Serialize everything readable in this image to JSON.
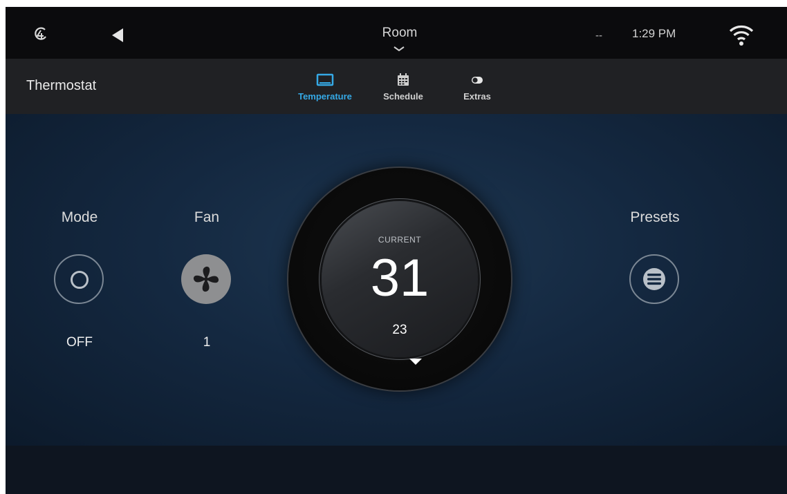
{
  "topbar": {
    "logo_icon": "brand-logo-icon",
    "back_icon": "back-triangle-icon",
    "room_label": "Room",
    "status_dashes": "--",
    "time": "1:29 PM",
    "wifi_icon": "wifi-icon"
  },
  "header": {
    "title": "Thermostat",
    "tabs": [
      {
        "label": "Temperature",
        "icon": "monitor-icon",
        "active": true
      },
      {
        "label": "Schedule",
        "icon": "calendar-icon",
        "active": false
      },
      {
        "label": "Extras",
        "icon": "toggle-icon",
        "active": false
      }
    ]
  },
  "controls": {
    "mode": {
      "title": "Mode",
      "value": "OFF",
      "icon": "power-ring-icon"
    },
    "fan": {
      "title": "Fan",
      "value": "1",
      "icon": "fan-icon"
    },
    "presets": {
      "title": "Presets",
      "icon": "list-icon"
    }
  },
  "dial": {
    "label": "CURRENT",
    "current_temp": "31",
    "setpoint": "23",
    "icon": "chevron-down-icon"
  },
  "colors": {
    "accent": "#35a9e6",
    "background": "#142840",
    "topbar": "#0b0b0d",
    "headbar": "#202124"
  }
}
